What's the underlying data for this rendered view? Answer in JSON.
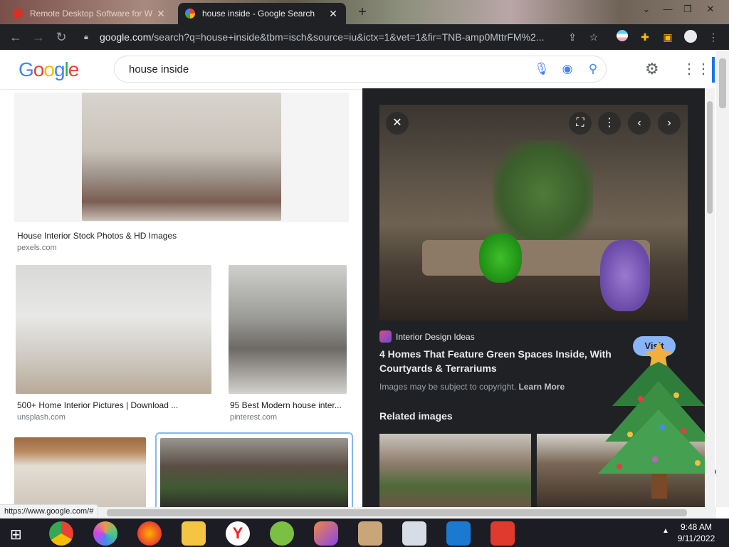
{
  "tabs": [
    {
      "title": "Remote Desktop Software for W",
      "active": false
    },
    {
      "title": "house inside - Google Search",
      "active": true
    }
  ],
  "toolbar": {
    "url_domain": "google.com",
    "url_rest": "/search?q=house+inside&tbm=isch&source=iu&ictx=1&vet=1&fir=TNB-amp0MttrFM%2..."
  },
  "google": {
    "logo": "Google",
    "query": "house inside"
  },
  "results": [
    {
      "title": "House Interior Stock Photos & HD Images",
      "source": "pexels.com"
    },
    {
      "title": "500+ Home Interior Pictures | Download ...",
      "source": "unsplash.com"
    },
    {
      "title": "95 Best Modern house inter...",
      "source": "pinterest.com"
    }
  ],
  "preview": {
    "site_name": "Interior Design Ideas",
    "title": "4 Homes That Feature Green Spaces Inside, With Courtyards & Terrariums",
    "copyright_text": "Images may be subject to copyright.",
    "learn_more": "Learn More",
    "visit_label": "Visit",
    "related_label": "Related images"
  },
  "status_url": "https://www.google.com/#",
  "clock": {
    "time": "9:48 AM",
    "date": "9/11/2022"
  },
  "colors": {
    "toolbar_bg": "#202124",
    "panel_bg": "#202124",
    "link_blue": "#8ab4f8"
  },
  "icons": [
    "back-icon",
    "forward-icon",
    "reload-icon",
    "lock-icon",
    "share-icon",
    "star-icon",
    "extension-icon",
    "profile-icon",
    "menu-icon",
    "mic-icon",
    "lens-icon",
    "search-icon",
    "settings-icon",
    "apps-icon",
    "close-icon",
    "more-icon",
    "prev-icon",
    "next-icon"
  ]
}
